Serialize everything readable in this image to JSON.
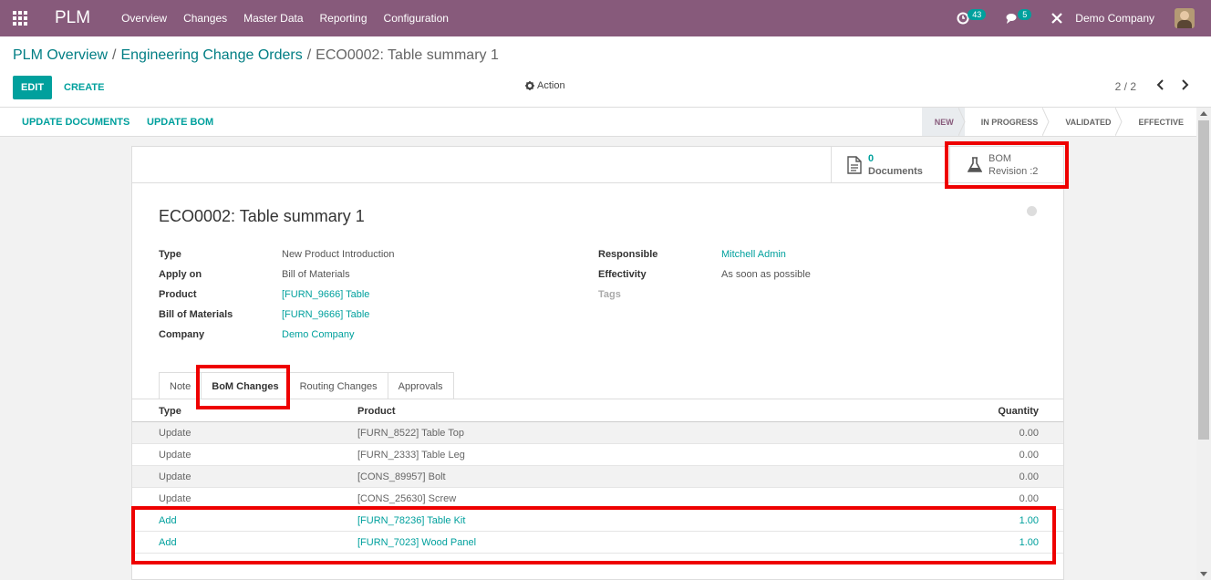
{
  "app": {
    "brand": "PLM",
    "menu": [
      "Overview",
      "Changes",
      "Master Data",
      "Reporting",
      "Configuration"
    ],
    "activities_count": "43",
    "messages_count": "5",
    "company": "Demo Company"
  },
  "breadcrumb": {
    "items": [
      "PLM Overview",
      "Engineering Change Orders"
    ],
    "current": "ECO0002: Table summary 1"
  },
  "toolbar": {
    "edit_label": "EDIT",
    "create_label": "CREATE",
    "action_label": "Action",
    "pager": "2 / 2"
  },
  "statusbar": {
    "buttons": [
      "UPDATE DOCUMENTS",
      "UPDATE BOM"
    ],
    "stages": [
      "NEW",
      "IN PROGRESS",
      "VALIDATED",
      "EFFECTIVE"
    ],
    "active_stage": "NEW"
  },
  "smart_buttons": {
    "documents_value": "0",
    "documents_label": "Documents",
    "bom_label": "BOM",
    "bom_revision": "Revision :2"
  },
  "record": {
    "title": "ECO0002: Table summary 1",
    "left_fields": [
      {
        "label": "Type",
        "value": "New Product Introduction"
      },
      {
        "label": "Apply on",
        "value": "Bill of Materials"
      },
      {
        "label": "Product",
        "value": "[FURN_9666] Table"
      },
      {
        "label": "Bill of Materials",
        "value": "[FURN_9666] Table"
      },
      {
        "label": "Company",
        "value": "Demo Company"
      }
    ],
    "right_fields": [
      {
        "label": "Responsible",
        "value": "Mitchell Admin"
      },
      {
        "label": "Effectivity",
        "value": "As soon as possible"
      },
      {
        "label": "Tags",
        "value": ""
      }
    ]
  },
  "tabs": [
    "Note",
    "BoM Changes",
    "Routing Changes",
    "Approvals"
  ],
  "active_tab": "BoM Changes",
  "bom_changes": {
    "columns": [
      "Type",
      "Product",
      "Quantity"
    ],
    "rows": [
      {
        "type": "Update",
        "product": "[FURN_8522] Table Top",
        "quantity": "0.00"
      },
      {
        "type": "Update",
        "product": "[FURN_2333] Table Leg",
        "quantity": "0.00"
      },
      {
        "type": "Update",
        "product": "[CONS_89957] Bolt",
        "quantity": "0.00"
      },
      {
        "type": "Update",
        "product": "[CONS_25630] Screw",
        "quantity": "0.00"
      },
      {
        "type": "Add",
        "product": "[FURN_78236] Table Kit",
        "quantity": "1.00"
      },
      {
        "type": "Add",
        "product": "[FURN_7023] Wood Panel",
        "quantity": "1.00"
      }
    ]
  },
  "colors": {
    "navbar": "#875a7b",
    "primary": "#00a09d",
    "highlight": "#ee0000"
  }
}
